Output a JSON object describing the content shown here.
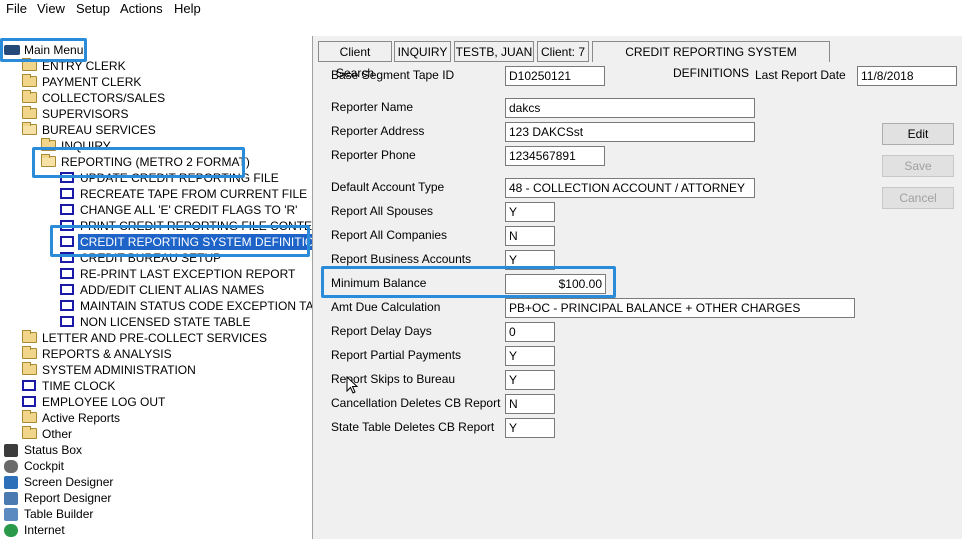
{
  "menu": [
    "File",
    "View",
    "Setup",
    "Actions",
    "Help"
  ],
  "tree": {
    "root": "Main Menu",
    "entry_clerk": "ENTRY CLERK",
    "payment_clerk": "PAYMENT CLERK",
    "collectors_sales": "COLLECTORS/SALES",
    "supervisors": "SUPERVISORS",
    "bureau_services": "BUREAU SERVICES",
    "inquiry": "INQUIRY",
    "reporting": "REPORTING (METRO 2 FORMAT)",
    "update_credit": "UPDATE CREDIT REPORTING FILE",
    "recreate_tape": "RECREATE TAPE FROM CURRENT FILE",
    "change_flags": "CHANGE ALL 'E' CREDIT FLAGS TO 'R'",
    "print_contents": "PRINT CREDIT REPORTING FILE CONTENTS",
    "system_definitions": "CREDIT REPORTING SYSTEM DEFINITIONS",
    "bureau_setup": "CREDIT BUREAU SETUP",
    "reprint_exception": "RE-PRINT LAST EXCEPTION REPORT",
    "alias_names": "ADD/EDIT CLIENT ALIAS NAMES",
    "status_exception": "MAINTAIN STATUS CODE EXCEPTION TABLE",
    "non_licensed": "NON LICENSED STATE TABLE",
    "letter_precollect": "LETTER AND PRE-COLLECT SERVICES",
    "reports_analysis": "REPORTS & ANALYSIS",
    "system_admin": "SYSTEM ADMINISTRATION",
    "time_clock": "TIME CLOCK",
    "employee_logout": "EMPLOYEE LOG OUT",
    "active_reports": "Active Reports",
    "other": "Other",
    "status_box": "Status Box",
    "cockpit": "Cockpit",
    "screen_designer": "Screen Designer",
    "report_designer": "Report Designer",
    "table_builder": "Table Builder",
    "internet": "Internet"
  },
  "tabs": {
    "client_search": "Client Search",
    "inquiry": "INQUIRY",
    "client_name": "TESTB, JUAN",
    "client_num": "Client: 7",
    "active": "CREDIT REPORTING SYSTEM DEFINITIONS"
  },
  "form": {
    "base_segment_label": "Base Segment Tape ID",
    "base_segment_value": "D10250121",
    "last_report_label": "Last Report Date",
    "last_report_value": "11/8/2018",
    "reporter_name_label": "Reporter Name",
    "reporter_name_value": "dakcs",
    "reporter_address_label": "Reporter Address",
    "reporter_address_value": "123 DAKCSst",
    "reporter_phone_label": "Reporter Phone",
    "reporter_phone_value": "1234567891",
    "default_type_label": "Default Account Type",
    "default_type_value": "48 - COLLECTION ACCOUNT / ATTORNEY",
    "spouses_label": "Report All Spouses",
    "spouses_value": "Y",
    "companies_label": "Report All Companies",
    "companies_value": "N",
    "business_label": "Report Business Accounts",
    "business_value": "Y",
    "min_balance_label": "Minimum Balance",
    "min_balance_value": "$100.00",
    "amt_due_label": "Amt Due Calculation",
    "amt_due_value": "PB+OC - PRINCIPAL BALANCE + OTHER CHARGES",
    "delay_label": "Report Delay Days",
    "delay_value": "0",
    "partial_label": "Report Partial Payments",
    "partial_value": "Y",
    "skips_label": "Report Skips to Bureau",
    "skips_value": "Y",
    "cancel_del_label": "Cancellation Deletes CB Report",
    "cancel_del_value": "N",
    "state_del_label": "State Table Deletes CB Report",
    "state_del_value": "Y"
  },
  "buttons": {
    "edit": "Edit",
    "save": "Save",
    "cancel": "Cancel"
  },
  "colors": {
    "highlight_border": "#2a8bd8",
    "selection": "#1e64c8",
    "panel_bg": "#f0f0f0"
  }
}
